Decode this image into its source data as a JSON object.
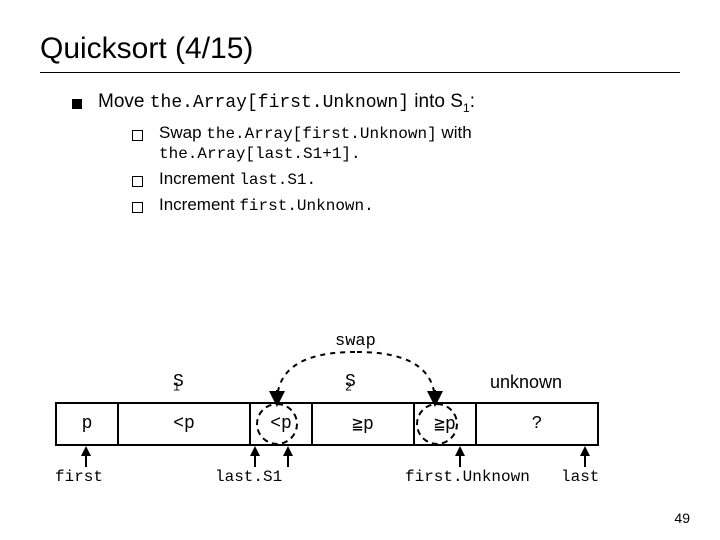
{
  "title": "Quicksort (4/15)",
  "bullet": {
    "pre": "Move ",
    "code": "the.Array[first.Unknown]",
    "post": " into S",
    "sub": "1",
    "tail": ":"
  },
  "subs": [
    {
      "pre": "Swap ",
      "code1": "the.Array[first.Unknown]",
      "mid": " with",
      "code2": "the.Array[last.S1+1]."
    },
    {
      "pre": "Increment ",
      "code1": "last.S1."
    },
    {
      "pre": "Increment ",
      "code1": "first.Unknown."
    }
  ],
  "swap_label": "swap",
  "regions": {
    "s1": "S",
    "s1_sub": "1",
    "s2": "S",
    "s2_sub": "2",
    "unknown": "unknown"
  },
  "cells": {
    "p": "p",
    "lt1": "<p",
    "lt2": "<p",
    "ge1": "≧p",
    "ge2": "≧p",
    "q": "?"
  },
  "pointers": {
    "first": "first",
    "lastS1": "last.S1",
    "firstUnknown": "first.Unknown",
    "last": "last"
  },
  "page_num": "49"
}
